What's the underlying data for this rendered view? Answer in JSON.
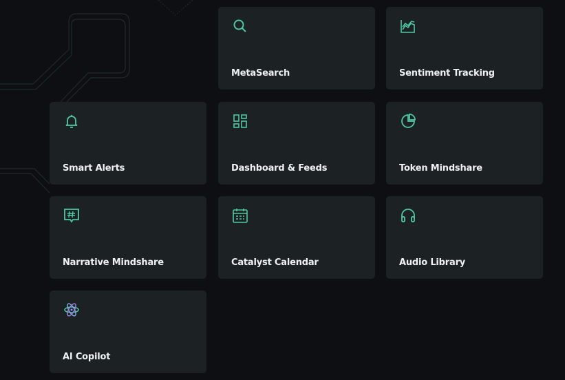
{
  "accent_color": "#4fc9a0",
  "tiles": [
    {
      "label": "MetaSearch",
      "icon": "search-icon"
    },
    {
      "label": "Sentiment Tracking",
      "icon": "area-chart-icon"
    },
    {
      "label": "Smart Alerts",
      "icon": "bell-icon"
    },
    {
      "label": "Dashboard & Feeds",
      "icon": "grid-icon"
    },
    {
      "label": "Token Mindshare",
      "icon": "pie-chart-icon"
    },
    {
      "label": "Narrative Mindshare",
      "icon": "hashtag-message-icon"
    },
    {
      "label": "Catalyst Calendar",
      "icon": "calendar-icon"
    },
    {
      "label": "Audio Library",
      "icon": "headphones-icon"
    },
    {
      "label": "AI Copilot",
      "icon": "atom-icon"
    }
  ]
}
